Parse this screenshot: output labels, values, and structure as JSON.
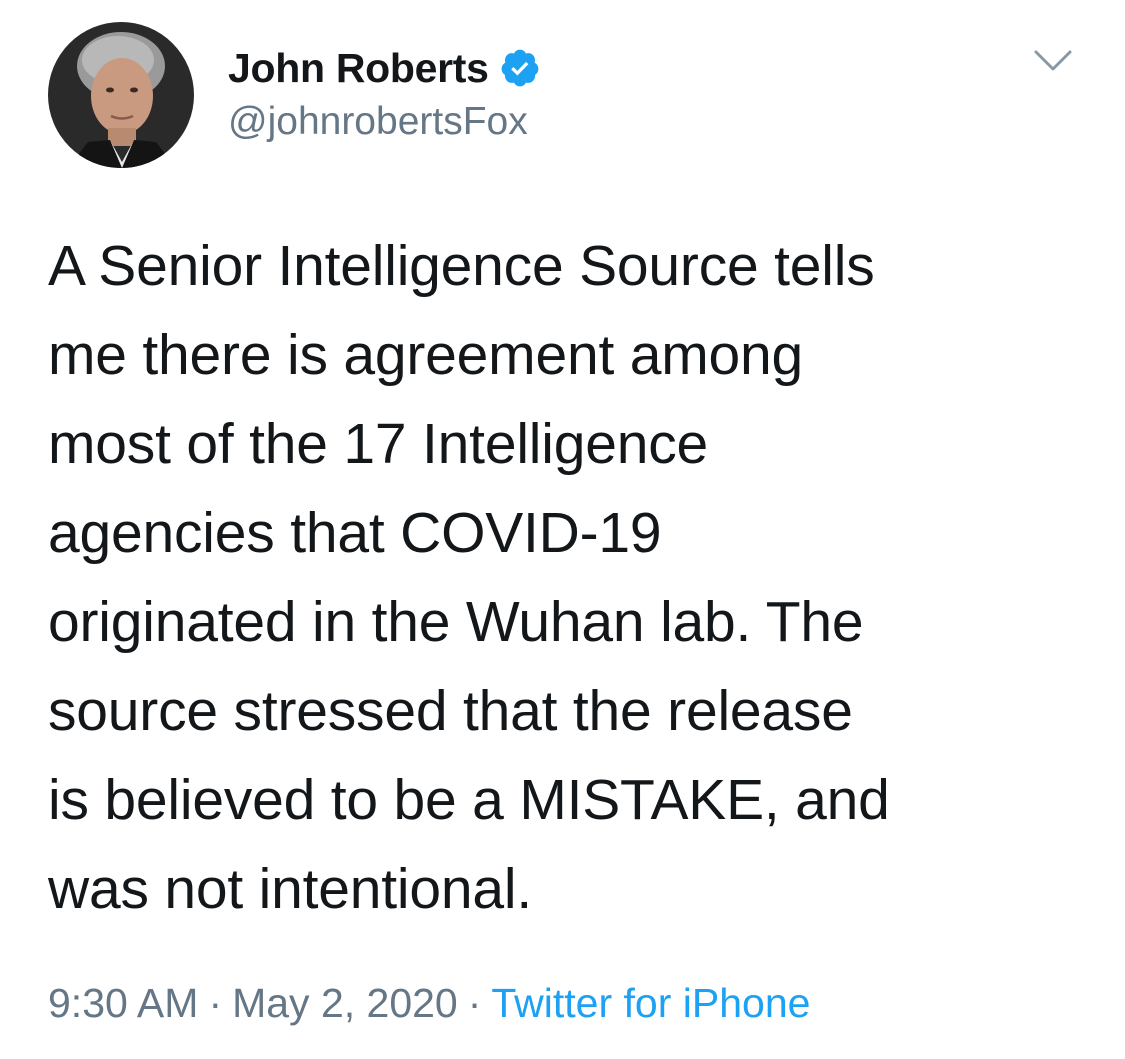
{
  "author": {
    "display_name": "John Roberts",
    "handle": "@johnrobertsFox",
    "verified": true
  },
  "tweet": {
    "lines": [
      "A Senior Intelligence Source tells",
      "me there is agreement among",
      "most of the 17 Intelligence",
      "agencies that COVID-19",
      "originated in the Wuhan lab. The",
      "source stressed that the release",
      "is believed to be a MISTAKE, and",
      "was not intentional."
    ]
  },
  "meta": {
    "time": "9:30 AM",
    "date": "May 2, 2020",
    "separator": "·",
    "source": "Twitter for iPhone"
  },
  "icons": {
    "verified": "verified-badge-icon",
    "menu": "chevron-down-icon"
  },
  "colors": {
    "text": "#14171a",
    "secondary": "#657786",
    "accent": "#1da1f2"
  }
}
